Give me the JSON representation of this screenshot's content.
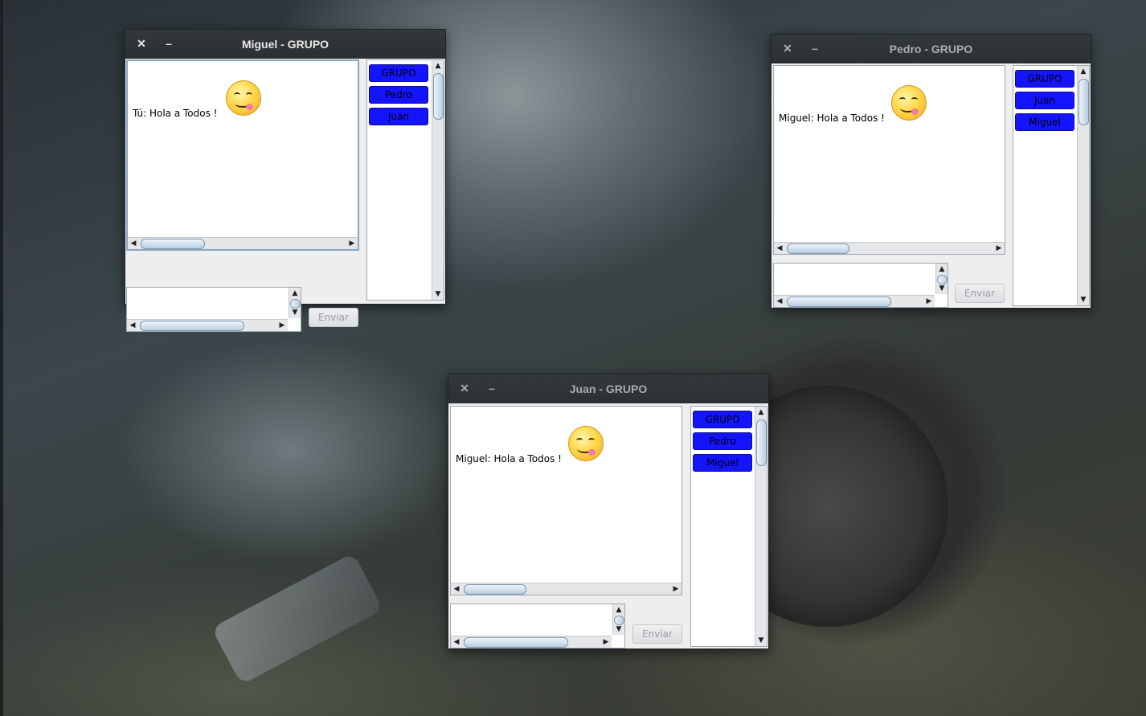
{
  "windows": {
    "miguel": {
      "title": "Miguel - GRUPO",
      "close_glyph": "✕",
      "minimize_glyph": "–",
      "message": "Tú: Hola a Todos !",
      "send_label": "Enviar",
      "users": [
        "GRUPO",
        "Pedro",
        "Juan"
      ]
    },
    "pedro": {
      "title": "Pedro - GRUPO",
      "close_glyph": "✕",
      "minimize_glyph": "–",
      "message": "Miguel: Hola a Todos !",
      "send_label": "Enviar",
      "users": [
        "GRUPO",
        "Juan",
        "Miguel"
      ]
    },
    "juan": {
      "title": "Juan - GRUPO",
      "close_glyph": "✕",
      "minimize_glyph": "–",
      "message": "Miguel: Hola a Todos !",
      "send_label": "Enviar",
      "users": [
        "GRUPO",
        "Pedro",
        "Miguel"
      ]
    }
  },
  "icons": {
    "emoji": "smiley-tongue-icon",
    "scroll_left": "◀",
    "scroll_right": "▶",
    "scroll_up": "▲",
    "scroll_down": "▼"
  },
  "colors": {
    "user_button": "#1414ff",
    "titlebar": "#2b3032"
  }
}
